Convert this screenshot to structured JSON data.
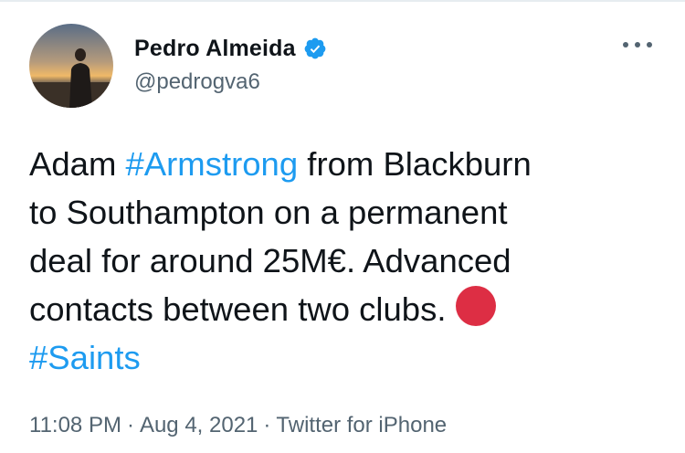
{
  "author": {
    "display_name": "Pedro Almeida",
    "handle": "@pedrogva6",
    "verified": true,
    "avatar_icon": "profile-photo"
  },
  "menu": {
    "icon": "more-dots-icon",
    "glyph": "···"
  },
  "tweet": {
    "lines": [
      {
        "before": "Adam ",
        "hashtag": "#Armstrong",
        "after": " from Blackburn"
      },
      {
        "text": "to Southampton on a permanent"
      },
      {
        "text": "deal for around 25M€. Advanced"
      },
      {
        "text": "contacts between two clubs.",
        "emoji": "red-circle"
      },
      {
        "hashtag": "#Saints"
      }
    ]
  },
  "meta": {
    "time": "11:08 PM",
    "date": "Aug 4, 2021",
    "source": "Twitter for iPhone",
    "separator": "·"
  },
  "colors": {
    "link": "#1d9bf0",
    "text": "#0f1419",
    "secondary": "#536471",
    "verified": "#1d9bf0",
    "red_circle": "#dd2e44"
  }
}
